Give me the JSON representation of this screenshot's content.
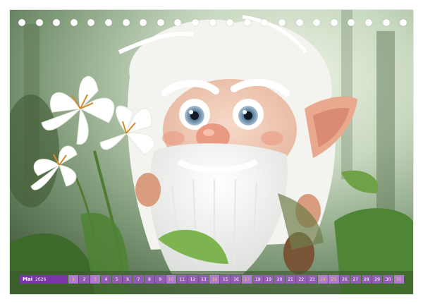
{
  "calendar": {
    "month": "Mai",
    "year": "2026",
    "days": [
      "1",
      "2",
      "3",
      "4",
      "5",
      "6",
      "7",
      "8",
      "9",
      "10",
      "11",
      "12",
      "13",
      "14",
      "15",
      "16",
      "17",
      "18",
      "19",
      "20",
      "21",
      "22",
      "23",
      "24",
      "25",
      "26",
      "27",
      "28",
      "29",
      "30",
      "31"
    ],
    "highlighted_days": [
      "1",
      "3",
      "10",
      "14",
      "17",
      "24",
      "25",
      "31"
    ],
    "colors": {
      "bar": "#7a36a8",
      "cell": "#9e5cc4",
      "highlight_text": "#f0d060"
    }
  },
  "binding": {
    "hole_count": 23
  },
  "illustration": {
    "icons": [
      "gnome-figure-icon",
      "white-lily-icon",
      "green-leaves-icon",
      "forest-background-icon"
    ]
  }
}
